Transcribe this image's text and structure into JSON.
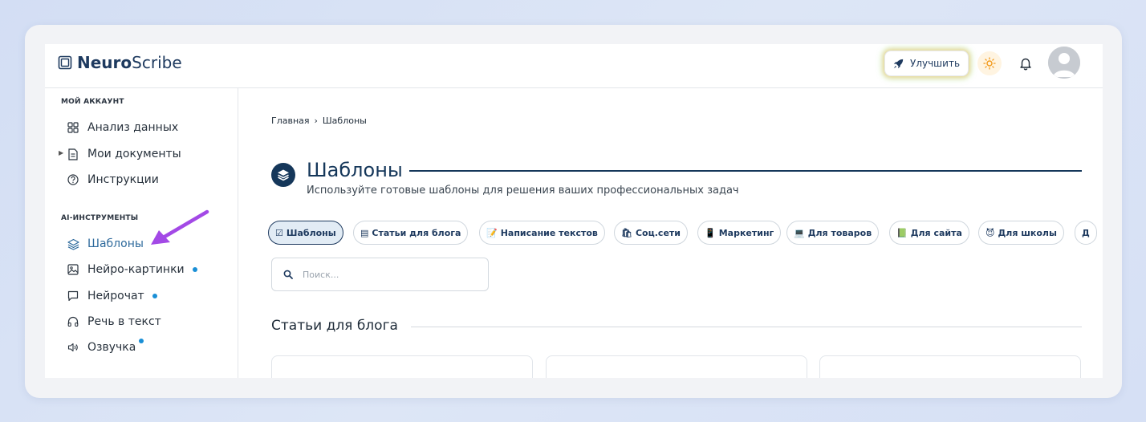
{
  "header": {
    "brand_bold": "Neuro",
    "brand_regular": "Scribe",
    "upgrade_label": "Улучшить"
  },
  "sidebar": {
    "account_title": "МОЙ АККАУНТ",
    "account_items": [
      {
        "label": "Анализ данных",
        "icon": "grid-icon"
      },
      {
        "label": "Мои документы",
        "icon": "document-icon"
      },
      {
        "label": "Инструкции",
        "icon": "help-circle-icon"
      }
    ],
    "ai_title": "AI-ИНСТРУМЕНТЫ",
    "ai_items": [
      {
        "label": "Шаблоны",
        "icon": "layers-icon",
        "active": true
      },
      {
        "label": "Нейро-картинки",
        "icon": "image-icon",
        "badge": true
      },
      {
        "label": "Нейрочат",
        "icon": "chat-icon",
        "badge": true
      },
      {
        "label": "Речь в текст",
        "icon": "headphones-icon"
      },
      {
        "label": "Озвучка",
        "icon": "speaker-icon",
        "badge": true
      }
    ]
  },
  "breadcrumb": {
    "home": "Главная",
    "separator": "›",
    "current": "Шаблоны"
  },
  "page": {
    "title": "Шаблоны",
    "subtitle": "Используйте готовые шаблоны для решения ваших профессиональных задач"
  },
  "chips": [
    {
      "emoji": "☑",
      "label": "Шаблоны",
      "active": true
    },
    {
      "emoji": "▤",
      "label": "Статьи для блога"
    },
    {
      "emoji": "📝",
      "label": "Написание текстов"
    },
    {
      "emoji": "🛍",
      "label": "Соц.сети"
    },
    {
      "emoji": "📱",
      "label": "Маркетинг"
    },
    {
      "emoji": "💻",
      "label": "Для товаров"
    },
    {
      "emoji": "📗",
      "label": "Для сайта"
    },
    {
      "emoji": "😈",
      "label": "Для школы"
    },
    {
      "emoji": "",
      "label": "Д"
    }
  ],
  "search": {
    "placeholder": "Поиск..."
  },
  "section": {
    "heading": "Статьи для блога"
  },
  "colors": {
    "brand": "#15375a",
    "accent_link": "#2e6a9c",
    "badge": "#1a8fd6",
    "annotation_arrow": "#a349e6"
  }
}
